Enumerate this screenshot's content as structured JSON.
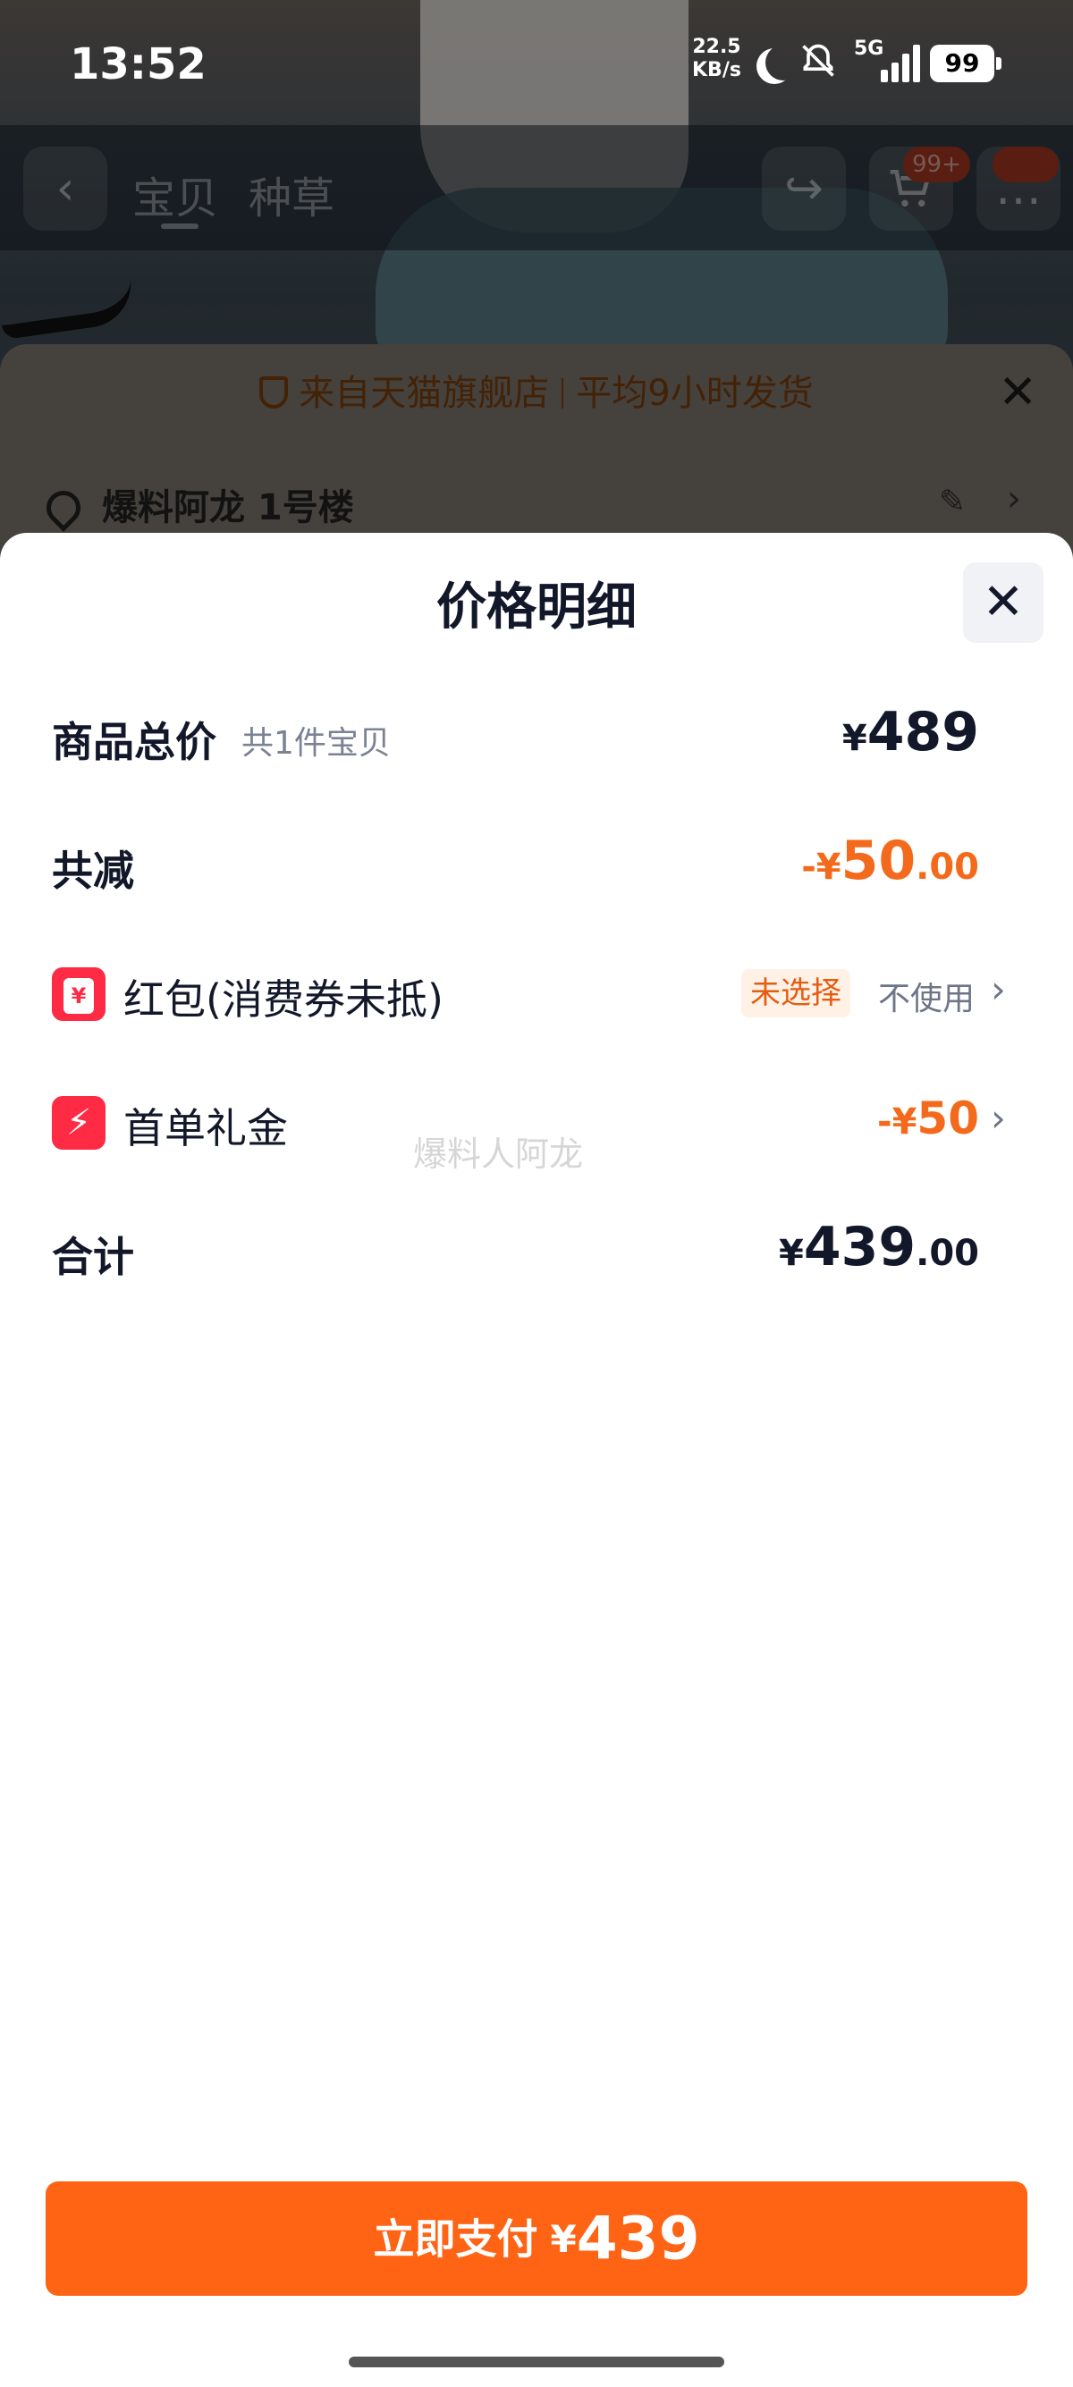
{
  "status_bar": {
    "time": "13:52",
    "net_speed_value": "22.5",
    "net_speed_unit": "KB/s",
    "network": "5G",
    "battery": "99"
  },
  "app_header": {
    "tabs": [
      "宝贝",
      "种草"
    ],
    "cart_badge": "99+",
    "icons": [
      "back-icon",
      "share-icon",
      "cart-icon",
      "message-icon"
    ]
  },
  "checkout": {
    "banner_left": "来自天猫旗舰店",
    "banner_right": "平均9小时发货",
    "address": "爆料阿龙 1号楼"
  },
  "price_detail": {
    "title": "价格明细",
    "total": {
      "label": "商品总价",
      "sub": "共1件宝贝",
      "currency": "¥",
      "amount": "489"
    },
    "discount": {
      "label": "共减",
      "prefix": "-¥",
      "amount": "50",
      "decimals": ".00"
    },
    "red_packet": {
      "label": "红包(消费券未抵)",
      "tag": "未选择",
      "action": "不使用"
    },
    "first_order": {
      "label": "首单礼金",
      "prefix": "-¥",
      "amount": "50"
    },
    "sum": {
      "label": "合计",
      "currency": "¥",
      "amount": "439",
      "decimals": ".00"
    },
    "watermark": "爆料人阿龙"
  },
  "pay_button": {
    "label": "立即支付",
    "currency": "¥",
    "amount": "439"
  },
  "colors": {
    "accent": "#ff6314",
    "discount": "#f36a1c",
    "coupon_red": "#ff2a44",
    "text_dark": "#12172a"
  }
}
